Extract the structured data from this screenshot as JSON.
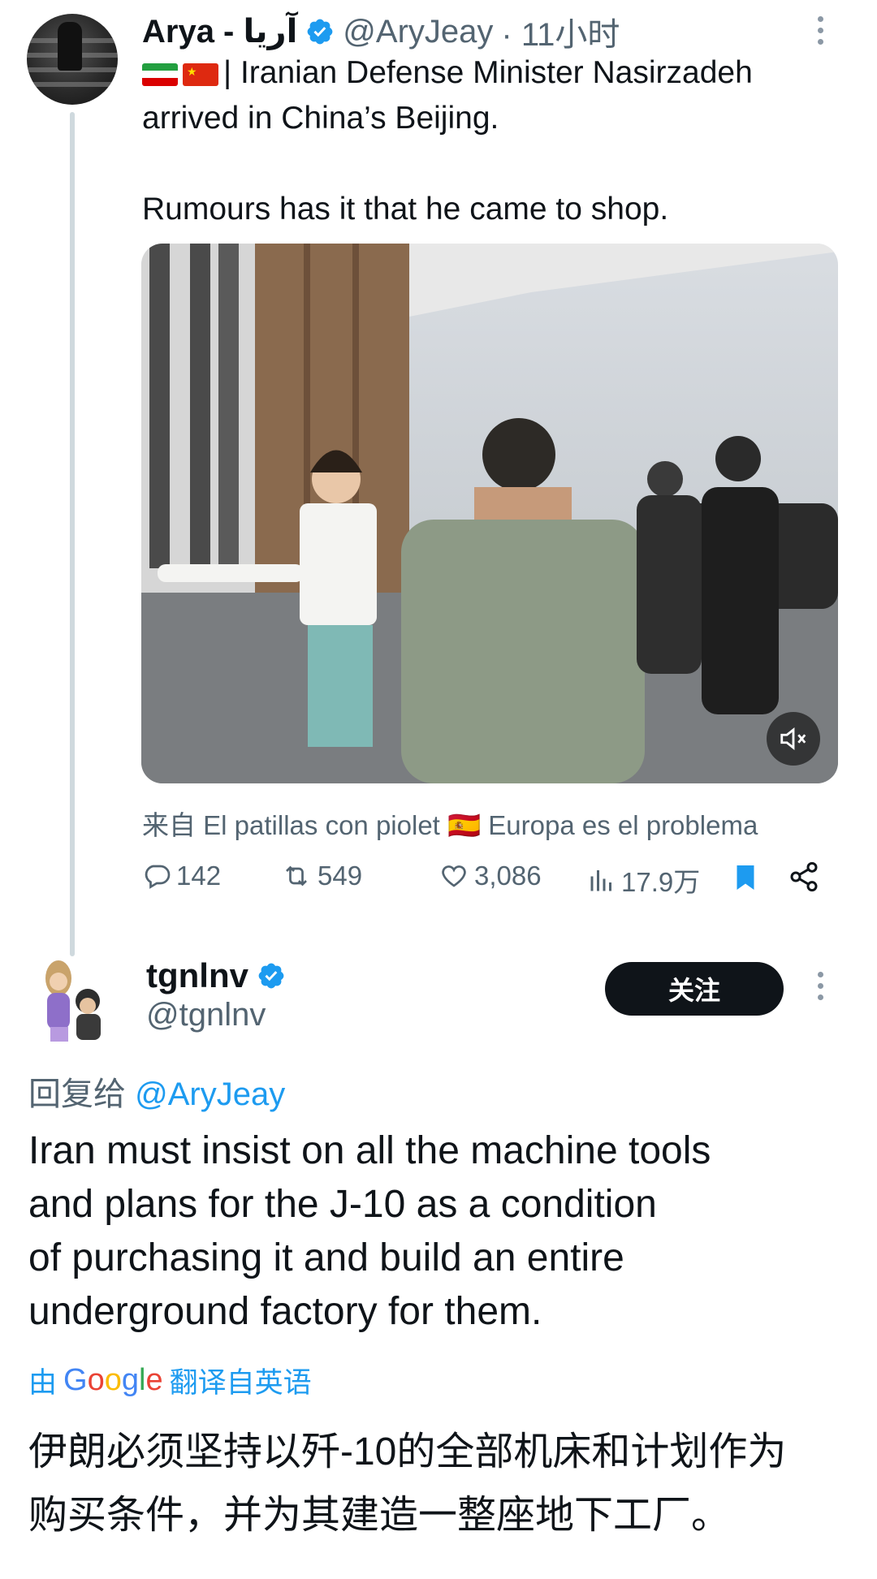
{
  "tweet1": {
    "display_name": "Arya - آریا",
    "handle": "@AryJeay",
    "time": "· 11小时",
    "line1": "| Iranian Defense Minister Nasirzadeh",
    "line2": "arrived in China’s Beijing.",
    "line3": "Rumours has it that he came to shop.",
    "video_from": "来自 El patillas con piolet 🇪🇸 Europa es el problema",
    "replies": "142",
    "retweets": "549",
    "likes": "3,086",
    "views": "17.9万"
  },
  "tweet2": {
    "display_name": "tgnlnv",
    "handle": "@tgnlnv",
    "follow_label": "关注",
    "reply_prefix": "回复给",
    "reply_mention": "@AryJeay",
    "body_lines": [
      "Iran must insist on all the machine tools",
      "and plans for the J-10 as a condition",
      "of purchasing it and build an entire",
      "underground factory for them."
    ],
    "translate_prefix": "由",
    "translate_suffix": "翻译自英语",
    "translated_lines": [
      "伊朗必须坚持以歼-10的全部机床和计划作为",
      "购买条件，并为其建造一整座地下工厂。"
    ]
  },
  "colors": {
    "accent": "#1d9bf0",
    "text": "#0f1419",
    "muted": "#536471",
    "verified": "#1d9bf0"
  },
  "icons": [
    "verified-badge-icon",
    "more-icon",
    "reply-icon",
    "retweet-icon",
    "like-icon",
    "views-icon",
    "bookmark-icon",
    "share-icon",
    "mute-icon",
    "iran-flag-icon",
    "china-flag-icon",
    "spain-flag-icon"
  ]
}
